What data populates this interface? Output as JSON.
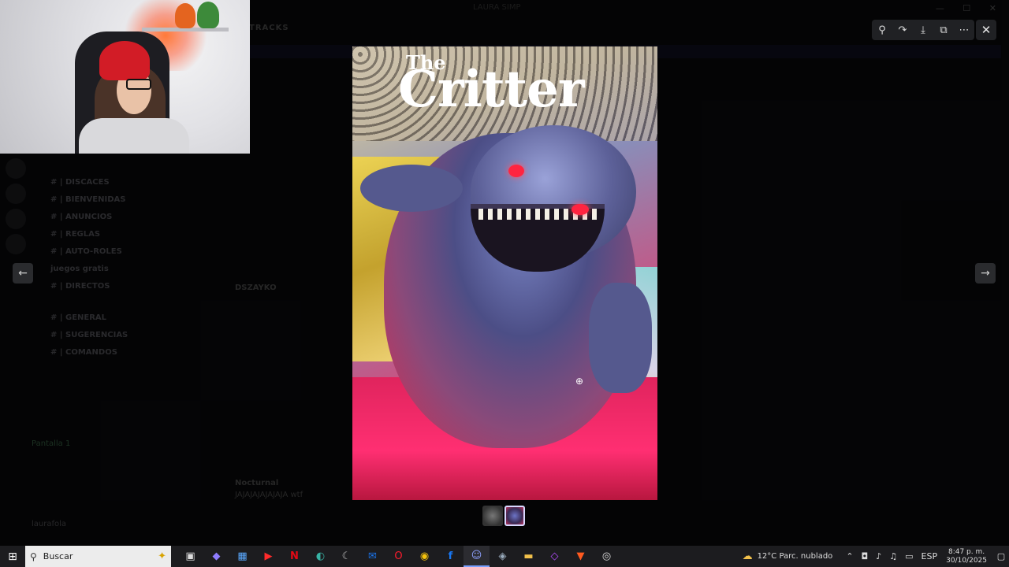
{
  "app": {
    "window_title": "LAURA SIMP",
    "chat_header": "TRACKS"
  },
  "webcam": {
    "label": "webcam feed"
  },
  "sidebar": {
    "channels": [
      {
        "label": "# | DISCACES"
      },
      {
        "label": "# | BIENVENIDAS"
      },
      {
        "label": "# | ANUNCIOS"
      },
      {
        "label": "# | REGLAS"
      },
      {
        "label": "# | AUTO-ROLES"
      },
      {
        "label": "juegos gratis"
      },
      {
        "label": "# | DIRECTOS"
      },
      {
        "label": "# | GENERAL"
      },
      {
        "label": "# | SUGERENCIAS"
      },
      {
        "label": "# | COMANDOS"
      }
    ],
    "voice_channel": "Pantalla 1",
    "user_name": "laurafola"
  },
  "chat": {
    "author1": "DSZAYKO",
    "author2": "Nocturnal",
    "text2": "JAJAJAJAJAJAJA wtf"
  },
  "viewer": {
    "image_title_small": "The",
    "image_title_main": "Critter",
    "toolbar": {
      "zoom_icon": "zoom-in-icon",
      "rotate_icon": "rotate-icon",
      "download_icon": "download-icon",
      "open_icon": "open-external-icon",
      "more_icon": "more-icon"
    },
    "thumbnails": [
      "thumbnail-1",
      "thumbnail-2"
    ]
  },
  "taskbar": {
    "search_placeholder": "Buscar",
    "weather": "12°C Parc. nublado",
    "language": "ESP",
    "time": "8:47 p. m.",
    "date": "30/10/2025"
  }
}
